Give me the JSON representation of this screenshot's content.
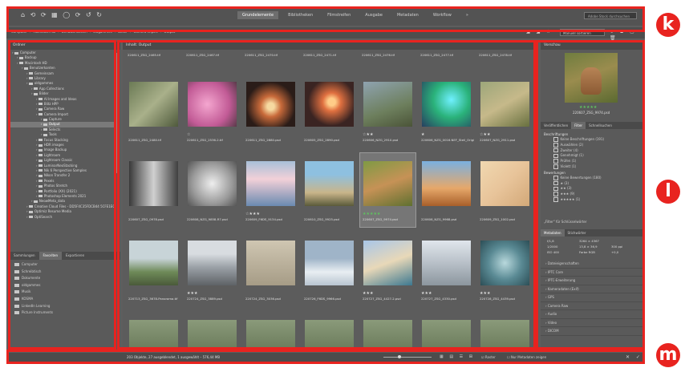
{
  "colors": {
    "accent": "#e8231f",
    "ui_bg": "#5e5e5e",
    "panel_header": "#4a4a4a",
    "selection": "#767676"
  },
  "topbar": {
    "tools": "⌂ ⟲ ⟳ ▦ ◯ ⟳ ↺ ↻",
    "tabs": [
      {
        "label": "Grundelemente",
        "active": true
      },
      {
        "label": "Bibliotheken",
        "active": false
      },
      {
        "label": "Filmstreifen",
        "active": false
      },
      {
        "label": "Ausgabe",
        "active": false
      },
      {
        "label": "Metadaten",
        "active": false
      },
      {
        "label": "Workflow",
        "active": false
      }
    ],
    "more": "»",
    "search_placeholder": "Adobe Stock durchsuchen"
  },
  "pathbar": {
    "crumbs": [
      "Computer",
      "Macintosh HD",
      "Benutzerkonten",
      "oldgammes",
      "Bilder",
      "Camera Import",
      "Output"
    ],
    "sort_label": "Manuell sortieren",
    "tools_left": "◢ ◢ ☆",
    "tools_right": "↻ ⧉ ▢ 🗑"
  },
  "left": {
    "header": "Ordner",
    "tree": [
      {
        "label": "Computer",
        "indent": 0
      },
      {
        "label": "Backup",
        "indent": 1
      },
      {
        "label": "Macintosh HD",
        "indent": 1
      },
      {
        "label": "Benutzerkonten",
        "indent": 2
      },
      {
        "label": "Gemeinsam",
        "indent": 3
      },
      {
        "label": "Library",
        "indent": 3
      },
      {
        "label": "oldgammes",
        "indent": 3
      },
      {
        "label": "App Collections",
        "indent": 4
      },
      {
        "label": "Bilder",
        "indent": 4
      },
      {
        "label": "AI Images and Ideas",
        "indent": 5
      },
      {
        "label": "Blitz HPP",
        "indent": 5
      },
      {
        "label": "Camera Raw",
        "indent": 5
      },
      {
        "label": "Camera Import",
        "indent": 5
      },
      {
        "label": "Capture",
        "indent": 6
      },
      {
        "label": "Output",
        "indent": 6,
        "selected": true
      },
      {
        "label": "Selects",
        "indent": 6
      },
      {
        "label": "Tools",
        "indent": 6
      },
      {
        "label": "Focus Stacking",
        "indent": 5
      },
      {
        "label": "HDR images",
        "indent": 5
      },
      {
        "label": "Image Backup",
        "indent": 5
      },
      {
        "label": "Lightroom",
        "indent": 5
      },
      {
        "label": "Lightroom Classic",
        "indent": 5
      },
      {
        "label": "LuminarNeoStacking",
        "indent": 5
      },
      {
        "label": "Nik 6 Perspective Samples",
        "indent": 5
      },
      {
        "label": "Nikon Transfer 2",
        "indent": 5
      },
      {
        "label": "Pexels",
        "indent": 5
      },
      {
        "label": "Photos Stretch",
        "indent": 5
      },
      {
        "label": "Portfolio (XX) (2021)",
        "indent": 5
      },
      {
        "label": "Photoshop Elements 2021",
        "indent": 5
      },
      {
        "label": "NeowMeta_data",
        "indent": 4
      },
      {
        "label": "Creative Cloud Files - DD5F4C35FDCB44 5CFE1E014A1",
        "indent": 3
      },
      {
        "label": "Optimiz Resume Media",
        "indent": 3
      },
      {
        "label": "OptiSearch",
        "indent": 3
      }
    ],
    "fav_tabs": [
      {
        "label": "Sammlungen",
        "active": false
      },
      {
        "label": "Favoriten",
        "active": true
      },
      {
        "label": "Exportieren",
        "active": false
      }
    ],
    "favorites": [
      "Computer",
      "Schreibtisch",
      "Dokumente",
      "oldgammes",
      "Musik",
      "KOSMA",
      "LinkedIn Learning",
      "Picture Instruments"
    ]
  },
  "content": {
    "header": "Inhalt: Output",
    "top_names": [
      "220611_ZSG_2465.tif",
      "220611_ZSG_2467.tif",
      "220611_ZSG_2470.tif",
      "220611_ZSG_2471.tif",
      "220611_ZSG_2476.tif",
      "220611_ZSG_2477.tif",
      "220611_ZSG_2478.tif"
    ],
    "rows": [
      [
        {
          "name": "220611_ZSG_2480.tif",
          "stars": ""
        },
        {
          "name": "220611_ZSG_2536-2.tif",
          "stars": "☆"
        },
        {
          "name": "220611_ZSG_2880.psd",
          "stars": ""
        },
        {
          "name": "220605_ZSG_2890.psd",
          "stars": ""
        },
        {
          "name": "220606_NZG_2910.psd",
          "stars": "☆★★"
        },
        {
          "name": "220606_NZG_0016.NEF_Stell_Original-fertig.psd",
          "stars": "★"
        },
        {
          "name": "220607_NZG_2911.psd",
          "stars": "☆★★"
        }
      ],
      [
        {
          "name": "220607_ZSG_0978.psd",
          "stars": ""
        },
        {
          "name": "220608_NZG_9858-R7.psd",
          "stars": ""
        },
        {
          "name": "220609_F6DS_9134.psd",
          "stars": "☆★★★"
        },
        {
          "name": "220610_ZSG_9925.psd",
          "stars": ""
        },
        {
          "name": "220607_ZSG_9974.psd",
          "stars": "★★★★★",
          "selected": true
        },
        {
          "name": "220608_NZG_9968.psd",
          "stars": ""
        },
        {
          "name": "220609_ZSG_1002.psd",
          "stars": ""
        }
      ],
      [
        {
          "name": "220713_ZSG_3678-Panorama.tif",
          "stars": ""
        },
        {
          "name": "220724_ZSG_3889.psd",
          "stars": "★★★"
        },
        {
          "name": "220724_ZSG_3036.psd",
          "stars": ""
        },
        {
          "name": "220726_F6DS_9966.psd",
          "stars": ""
        },
        {
          "name": "220727_ZSG_4427-2.psd",
          "stars": "★★★"
        },
        {
          "name": "220727_ZSG_4330.psd",
          "stars": "★★★"
        },
        {
          "name": "220728_ZSG_4439.psd",
          "stars": "★★★"
        }
      ]
    ]
  },
  "right": {
    "header": "Vorschau",
    "preview_stars": "★★★★★",
    "preview_name": "220607_ZSG_9974.psd",
    "filter_tabs": [
      {
        "label": "Veröffentlichen",
        "active": false
      },
      {
        "label": "Filter",
        "active": true
      },
      {
        "label": "Schnellsuchen",
        "active": false
      }
    ],
    "filter_sections": [
      {
        "title": "Beschriftungen",
        "options": [
          "Keine Beschriftungen (191)",
          "Auswählen (2)",
          "Zweiter (4)",
          "Genehmigt (1)",
          "Prüfen (1)",
          "Violett (1)"
        ]
      },
      {
        "title": "Bewertungen",
        "options": [
          "Keine Bewertungen (180)",
          "★ (3)",
          "★★ (3)",
          "★★★ (9)",
          "★★★★★ (1)"
        ]
      }
    ],
    "pin_filter": "„Filter\" für Schlüsselwörter",
    "meta_tabs": [
      {
        "label": "Metadaten",
        "active": true
      },
      {
        "label": "Stichwörter",
        "active": false
      }
    ],
    "camera": {
      "aperture": "f/1,8",
      "shutter": "1/2000",
      "exposure": "+0,0",
      "iso": "ISO 400",
      "size": "3264 × 4367",
      "res": "300 ppi",
      "dims": "13,8 × 36,9",
      "mode": "Farbe RGB"
    },
    "meta_sections": [
      "Dateieigenschaften",
      "IPTC Core",
      "IPTC-Erweiterung",
      "Kameradaten (Exif)",
      "GPS",
      "Camera Raw",
      "Audio",
      "Video",
      "DICOM"
    ]
  },
  "status": {
    "text": "203 Objekte, 27 ausgeblendet, 1 ausgewählt – 576,44 MB",
    "check1": "Raster",
    "check2": "Nur Metadaten zeigen"
  },
  "badges": {
    "top": "k",
    "middle": "l",
    "bottom": "m"
  }
}
